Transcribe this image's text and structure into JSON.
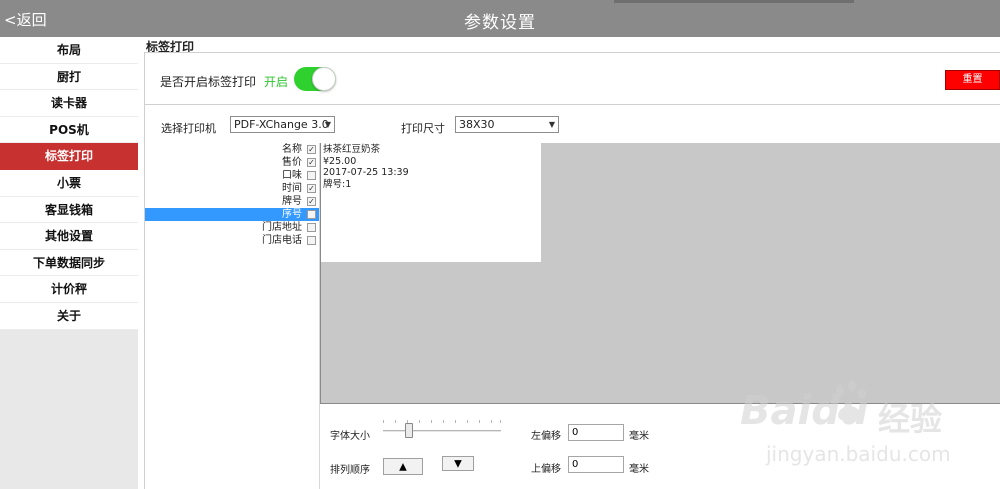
{
  "header": {
    "back_label": "<返回",
    "title": "参数设置"
  },
  "sidebar": {
    "items": [
      {
        "label": "布局"
      },
      {
        "label": "厨打"
      },
      {
        "label": "读卡器"
      },
      {
        "label": "POS机"
      },
      {
        "label": "标签打印",
        "active": true
      },
      {
        "label": "小票"
      },
      {
        "label": "客显钱箱"
      },
      {
        "label": "其他设置"
      },
      {
        "label": "下单数据同步"
      },
      {
        "label": "计价秤"
      },
      {
        "label": "关于"
      }
    ]
  },
  "main": {
    "section_title": "标签打印",
    "enable_label": "是否开启标签打印",
    "enable_state": "开启",
    "reset_label": "重置",
    "printer_label": "选择打印机",
    "printer_value": "PDF-XChange 3.0",
    "size_label": "打印尺寸",
    "size_value": "38X30",
    "fields": [
      {
        "name": "名称",
        "checked": true
      },
      {
        "name": "售价",
        "checked": true
      },
      {
        "name": "口味",
        "checked": false
      },
      {
        "name": "时间",
        "checked": true
      },
      {
        "name": "牌号",
        "checked": true
      },
      {
        "name": "序号",
        "checked": false,
        "selected": true
      },
      {
        "name": "门店地址",
        "checked": false
      },
      {
        "name": "门店电话",
        "checked": false
      }
    ],
    "preview_lines": [
      "抹茶红豆奶茶",
      "¥25.00",
      "2017-07-25 13:39",
      "牌号:1"
    ],
    "font_size_label": "字体大小",
    "font_size_value": 0.2,
    "order_label": "排列顺序",
    "left_offset_label": "左偏移",
    "left_offset_value": "0",
    "top_offset_label": "上偏移",
    "top_offset_value": "0",
    "unit_label": "毫米"
  },
  "watermark": {
    "brand": "Baidu",
    "cn": "经验",
    "url": "jingyan.baidu.com"
  },
  "colors": {
    "topbar": "#8a8a8a",
    "active_item": "#c7312f",
    "toggle_on": "#2fd12f",
    "reset_button": "#ff0000",
    "selected_row": "#3399ff"
  }
}
